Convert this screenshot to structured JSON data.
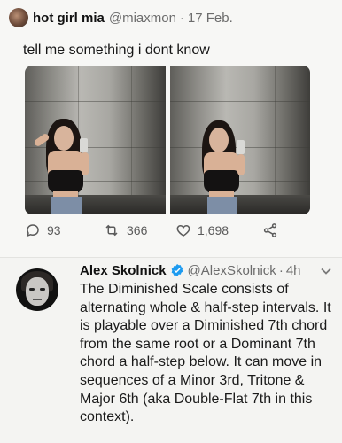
{
  "tweet1": {
    "author_name": "hot girl mia",
    "handle": "@miaxmon",
    "separator": "·",
    "date": "17 Feb.",
    "text": "tell me something i dont know",
    "stats": {
      "replies": "93",
      "retweets": "366",
      "likes": "1,698"
    },
    "icons": [
      "reply-icon",
      "retweet-icon",
      "like-icon",
      "share-icon"
    ]
  },
  "tweet2": {
    "author_name": "Alex Skolnick",
    "handle": "@AlexSkolnick",
    "separator": "·",
    "time": "4h",
    "verified": true,
    "text_lines": [
      "The Diminished Scale consists of",
      "alternating whole & half-step intervals. It",
      "is playable over a Diminished 7th chord",
      "from the same root or a Dominant 7th",
      "chord a half-step below. It can move in",
      "sequences of a Minor 3rd, Tritone &",
      "Major 6th (aka Double-Flat 7th in this",
      "context)."
    ],
    "icons": [
      "verified-badge-icon",
      "chevron-down-icon"
    ]
  },
  "colors": {
    "background": "#f4f4f2",
    "secondary_text": "#6c6c6c",
    "verified_blue": "#1d9bf0"
  }
}
